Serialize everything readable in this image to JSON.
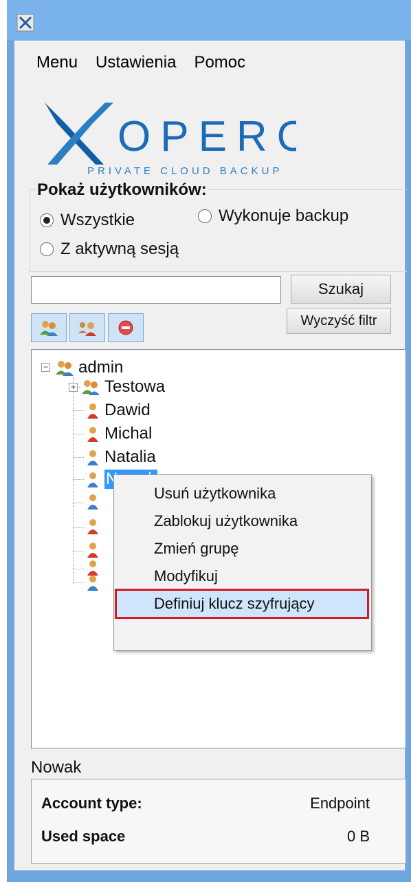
{
  "menu": {
    "items": [
      "Menu",
      "Ustawienia",
      "Pomoc"
    ]
  },
  "logo": {
    "brand": "XOPERO",
    "tagline": "PRIVATE CLOUD BACKUP"
  },
  "filter": {
    "title": "Pokaż użytkowników:",
    "options": [
      {
        "label": "Wszystkie",
        "checked": true
      },
      {
        "label": "Wykonuje backup",
        "checked": false
      },
      {
        "label": "Z aktywną sesją",
        "checked": false
      }
    ]
  },
  "search": {
    "value": "",
    "button": "Szukaj",
    "clear_button": "Wyczyść filtr"
  },
  "toolbar": {
    "icons": [
      "group-icon",
      "user-group-icon",
      "remove-icon"
    ]
  },
  "tree": {
    "root": "admin",
    "group": "Testowa",
    "users": [
      "Dawid",
      "Michal",
      "Natalia",
      "Nowak"
    ],
    "selected": "Nowak"
  },
  "context_menu": {
    "items": [
      "Usuń użytkownika",
      "Zablokuj użytkownika",
      "Zmień grupę",
      "Modyfikuj",
      "Definiuj klucz szyfrujący"
    ],
    "highlighted_index": 4
  },
  "details": {
    "name": "Nowak",
    "rows": [
      {
        "key": "Account type:",
        "value": "Endpoint"
      },
      {
        "key": "Used space",
        "value": "0 B"
      }
    ]
  },
  "colors": {
    "titlebar": "#7ab2ec",
    "highlight_border": "#d01b24",
    "selection": "#3399ff"
  }
}
